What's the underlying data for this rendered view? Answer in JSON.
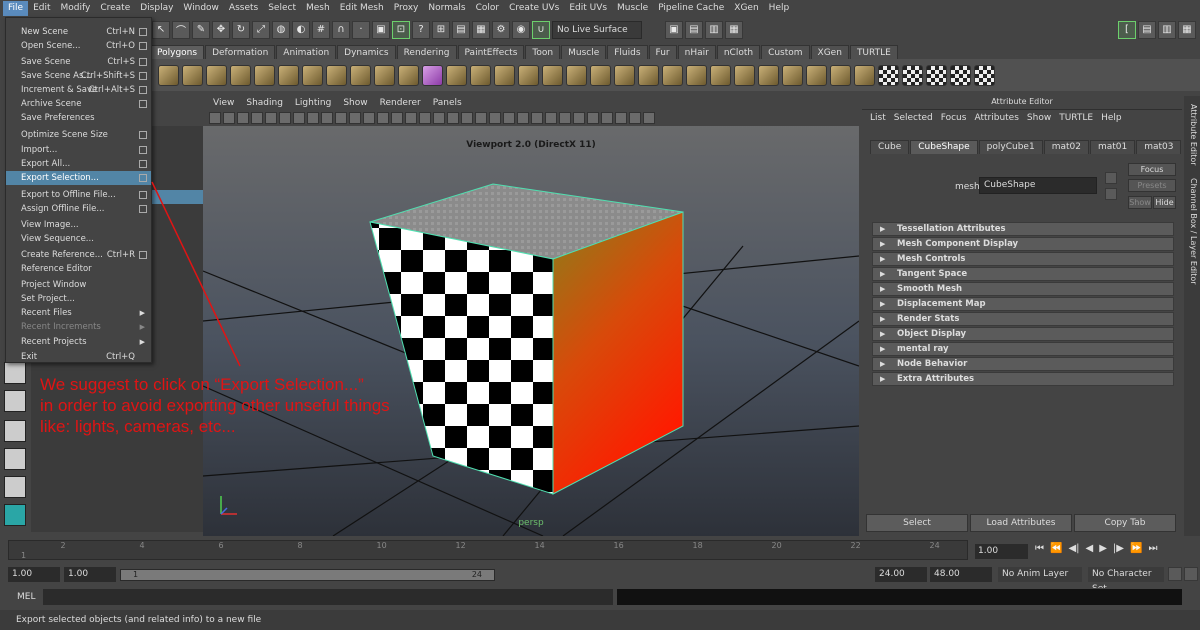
{
  "menubar": [
    "File",
    "Edit",
    "Modify",
    "Create",
    "Display",
    "Window",
    "Assets",
    "Select",
    "Mesh",
    "Edit Mesh",
    "Proxy",
    "Normals",
    "Color",
    "Create UVs",
    "Edit UVs",
    "Muscle",
    "Pipeline Cache",
    "XGen",
    "Help"
  ],
  "toolbar": {
    "live_surface": "No Live Surface"
  },
  "shelf_tabs": [
    "Polygons",
    "Deformation",
    "Animation",
    "Dynamics",
    "Rendering",
    "PaintEffects",
    "Toon",
    "Muscle",
    "Fluids",
    "Fur",
    "nHair",
    "nCloth",
    "Custom",
    "XGen",
    "TURTLE"
  ],
  "file_menu": [
    {
      "label": "New Scene",
      "shortcut": "Ctrl+N",
      "box": true
    },
    {
      "label": "Open Scene...",
      "shortcut": "Ctrl+O",
      "box": true
    },
    {
      "label": "Save Scene",
      "shortcut": "Ctrl+S",
      "box": true
    },
    {
      "label": "Save Scene As...",
      "shortcut": "Ctrl+Shift+S",
      "box": true
    },
    {
      "label": "Increment & Save",
      "shortcut": "Ctrl+Alt+S",
      "box": true
    },
    {
      "label": "Archive Scene",
      "shortcut": "",
      "box": true
    },
    {
      "label": "Save Preferences",
      "shortcut": "",
      "box": false
    },
    {
      "label": "Optimize Scene Size",
      "shortcut": "",
      "box": true
    },
    {
      "label": "Import...",
      "shortcut": "",
      "box": true
    },
    {
      "label": "Export All...",
      "shortcut": "",
      "box": true
    },
    {
      "label": "Export Selection...",
      "shortcut": "",
      "box": true
    },
    {
      "label": "Export to Offline File...",
      "shortcut": "",
      "box": true
    },
    {
      "label": "Assign Offline File...",
      "shortcut": "",
      "box": true
    },
    {
      "label": "View Image...",
      "shortcut": "",
      "box": false
    },
    {
      "label": "View Sequence...",
      "shortcut": "",
      "box": false
    },
    {
      "label": "Create Reference...",
      "shortcut": "Ctrl+R",
      "box": true
    },
    {
      "label": "Reference Editor",
      "shortcut": "",
      "box": false
    },
    {
      "label": "Project Window",
      "shortcut": "",
      "box": false
    },
    {
      "label": "Set Project...",
      "shortcut": "",
      "box": false
    },
    {
      "label": "Recent Files",
      "shortcut": "",
      "box": false,
      "submenu": true
    },
    {
      "label": "Recent Increments",
      "shortcut": "",
      "box": false,
      "submenu": true,
      "disabled": true
    },
    {
      "label": "Recent Projects",
      "shortcut": "",
      "box": false,
      "submenu": true
    },
    {
      "label": "Exit",
      "shortcut": "Ctrl+Q",
      "box": false
    }
  ],
  "viewport": {
    "menu": [
      "View",
      "Shading",
      "Lighting",
      "Show",
      "Renderer",
      "Panels"
    ],
    "title": "Viewport 2.0 (DirectX 11)",
    "camera": "persp"
  },
  "attribute_editor": {
    "title": "Attribute Editor",
    "menu": [
      "List",
      "Selected",
      "Focus",
      "Attributes",
      "Show",
      "TURTLE",
      "Help"
    ],
    "node_tabs": [
      "Cube",
      "CubeShape",
      "polyCube1",
      "mat02",
      "mat01",
      "mat03"
    ],
    "mesh_label": "mesh:",
    "mesh_value": "CubeShape",
    "focus": "Focus",
    "presets": "Presets",
    "show": "Show",
    "hide": "Hide",
    "sections": [
      "Tessellation Attributes",
      "Mesh Component Display",
      "Mesh Controls",
      "Tangent Space",
      "Smooth Mesh",
      "Displacement Map",
      "Render Stats",
      "Object Display",
      "mental ray",
      "Node Behavior",
      "Extra Attributes"
    ],
    "buttons": [
      "Select",
      "Load Attributes",
      "Copy Tab"
    ]
  },
  "right_tabs": [
    "Attribute Editor",
    "Channel Box / Layer Editor"
  ],
  "timeline": {
    "ticks": [
      "1",
      "2",
      "4",
      "6",
      "8",
      "10",
      "12",
      "14",
      "16",
      "18",
      "20",
      "22",
      "24"
    ],
    "current_frame": "1.00"
  },
  "range": {
    "start": "1.00",
    "playback_start": "1.00",
    "slider_start": "1",
    "slider_end": "24",
    "playback_end": "24.00",
    "end": "48.00",
    "anim_layer": "No Anim Layer",
    "character_set": "No Character Set"
  },
  "mel": {
    "label": "MEL"
  },
  "status": "Export selected objects (and related info) to a new file",
  "annotation": {
    "line1": "We suggest to click on “Export Selection...”",
    "line2": "in order to avoid exporting other unseful things",
    "line3": "like: lights, cameras, etc...",
    "color": "#e01414"
  },
  "colors": {
    "highlight": "#5285a6",
    "cube_edge": "#4fe0b0"
  }
}
